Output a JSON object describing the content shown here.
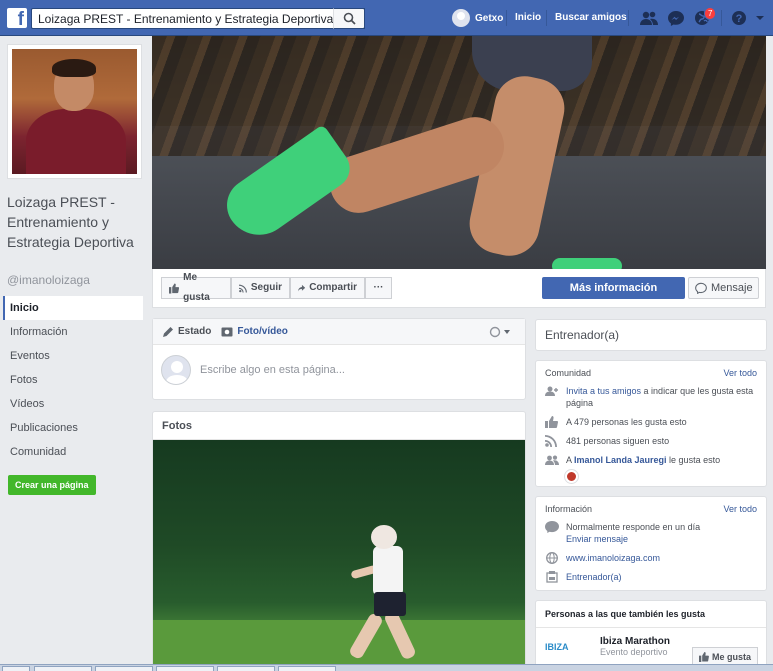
{
  "topbar": {
    "logo": "f",
    "search_value": "Loizaga PREST - Entrenamiento y Estrategia Deportiva",
    "user_name": "Getxo",
    "nav_home": "Inicio",
    "nav_find_friends": "Buscar amigos",
    "notifications_count": "7"
  },
  "page": {
    "name": "Loizaga PREST - Entrenamiento y Estrategia Deportiva",
    "handle": "@imanoloizaga"
  },
  "left_nav": {
    "items": [
      "Inicio",
      "Información",
      "Eventos",
      "Fotos",
      "Vídeos",
      "Publicaciones",
      "Comunidad"
    ],
    "create_page": "Crear una página"
  },
  "actions": {
    "like": "Me gusta",
    "follow": "Seguir",
    "share": "Compartir",
    "more": "···",
    "more_info": "Más información",
    "message": "Mensaje"
  },
  "composer": {
    "tab_status": "Estado",
    "tab_photo": "Foto/vídeo",
    "placeholder": "Escribe algo en esta página..."
  },
  "photos": {
    "title": "Fotos"
  },
  "right": {
    "category": "Entrenador(a)",
    "community": {
      "title": "Comunidad",
      "see_all": "Ver todo",
      "invite_link": "Invita a tus amigos",
      "invite_text": " a indicar que les gusta esta página",
      "likes": "A 479 personas les gusta esto",
      "followers": "481 personas siguen esto",
      "friend_prefix": "A ",
      "friend_name": "Imanol Landa Jauregi",
      "friend_suffix": " le gusta esto"
    },
    "info": {
      "title": "Información",
      "see_all": "Ver todo",
      "response": "Normalmente responde en un día",
      "send_message": "Enviar mensaje",
      "website": "www.imanoloizaga.com",
      "category": "Entrenador(a)"
    },
    "also_liked": {
      "title": "Personas a las que también les gusta",
      "logo_text": "IBIZA",
      "name": "Ibiza Marathon",
      "sub": "Evento deportivo",
      "like": "Me gusta"
    }
  }
}
